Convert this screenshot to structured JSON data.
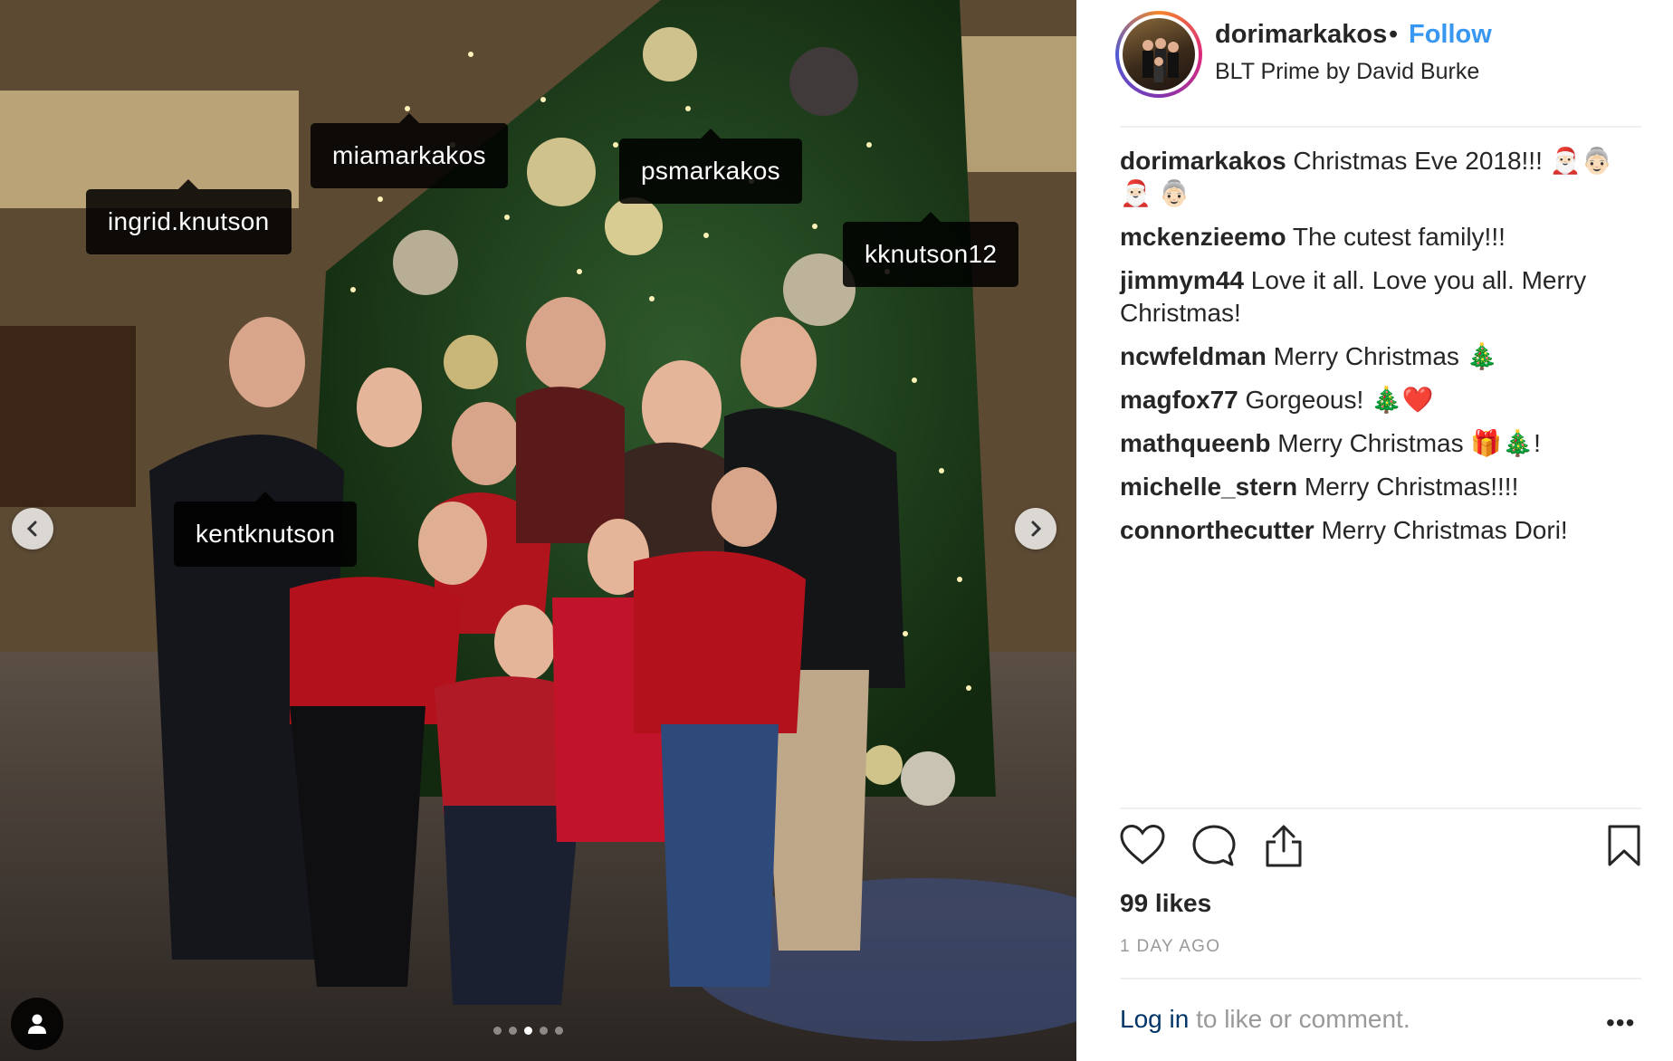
{
  "post": {
    "username": "dorimarkakos",
    "separator": "•",
    "follow_label": "Follow",
    "location": "BLT Prime by David Burke"
  },
  "photo": {
    "tags": [
      {
        "name": "miamarkakos"
      },
      {
        "name": "ingrid.knutson"
      },
      {
        "name": "psmarkakos"
      },
      {
        "name": "kknutson12"
      },
      {
        "name": "kentknutson"
      }
    ],
    "carousel": {
      "count": 5,
      "active_index": 2
    },
    "icons": {
      "prev": "chevron-left-icon",
      "next": "chevron-right-icon",
      "tagged_users": "user-icon"
    }
  },
  "comments": [
    {
      "user": "dorimarkakos",
      "text": "Christmas Eve 2018!!! 🎅🏻👵🏻🎅🏻 👵🏻"
    },
    {
      "user": "mckenzieemo",
      "text": "The cutest family!!!"
    },
    {
      "user": "jimmym44",
      "text": "Love it all. Love you all. Merry Christmas!"
    },
    {
      "user": "ncwfeldman",
      "text": "Merry Christmas 🎄"
    },
    {
      "user": "magfox77",
      "text": "Gorgeous! 🎄❤️"
    },
    {
      "user": "mathqueenb",
      "text": "Merry Christmas 🎁🎄!"
    },
    {
      "user": "michelle_stern",
      "text": "Merry Christmas!!!!"
    },
    {
      "user": "connorthecutter",
      "text": "Merry Christmas Dori!"
    }
  ],
  "actions": {
    "like": "heart-icon",
    "comment": "comment-bubble-icon",
    "share": "share-icon",
    "save": "bookmark-icon"
  },
  "likes": "99 likes",
  "timestamp": "1 DAY AGO",
  "login": {
    "link": "Log in",
    "rest": " to like or comment."
  },
  "more": "•••",
  "colors": {
    "follow": "#3897f0",
    "link": "#003569",
    "muted": "#999999"
  }
}
